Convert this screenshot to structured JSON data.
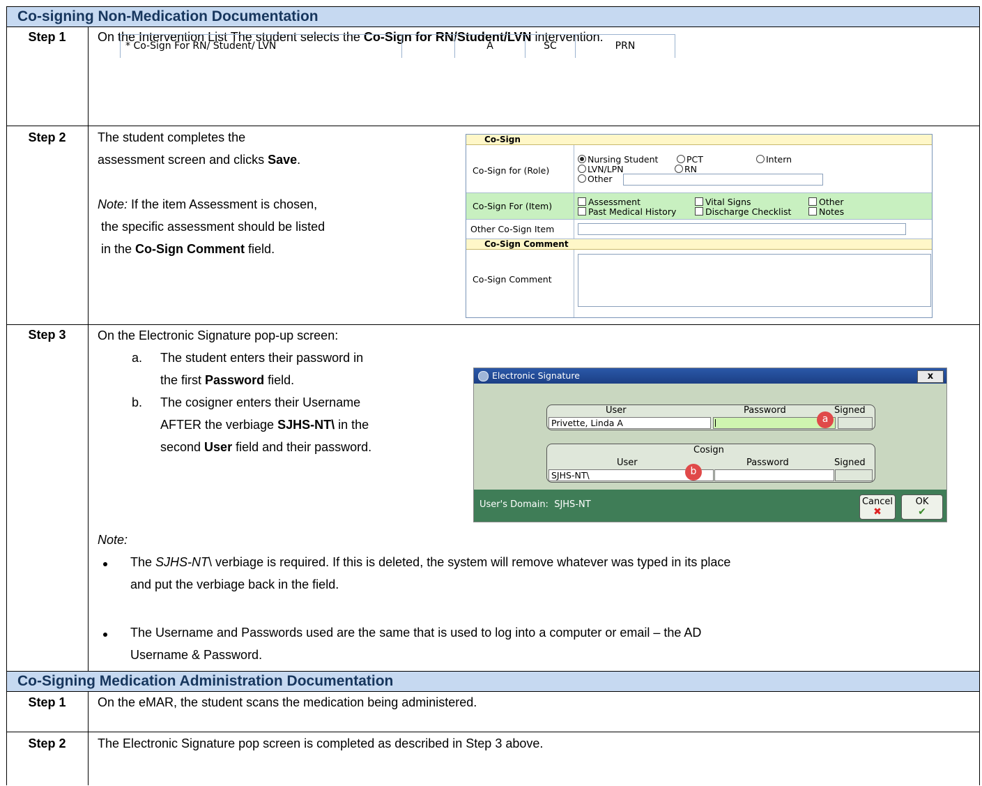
{
  "sections": [
    {
      "title": "Co-signing Non-Medication Documentation"
    },
    {
      "title": "Co-Signing Medication Administration Documentation"
    }
  ],
  "nonmed": {
    "step1": {
      "label": "Step 1",
      "pre": "On the Intervention List The student selects the ",
      "bold": "Co-Sign for RN/Student/LVN",
      "post": " intervention.",
      "intervention": {
        "name": "* Co-Sign For RN/ Student/ LVN",
        "col2": "",
        "col3": "A",
        "col4": "SC",
        "col5": "PRN"
      }
    },
    "step2": {
      "label": "Step 2",
      "line1": "The student completes the",
      "line2_pre": "assessment screen and clicks ",
      "line2_bold": "Save",
      "line2_post": ".",
      "note_label": "Note:",
      "note_line1": " If the item Assessment is chosen,",
      "note_line2": " the specific assessment should be listed",
      "note_line3_pre": " in the ",
      "note_line3_bold": "Co-Sign Comment",
      "note_line3_post": " field.",
      "form": {
        "hdr1": "Co-Sign",
        "role_label": "Co-Sign for (Role)",
        "roles": [
          "Nursing Student",
          "PCT",
          "Intern",
          "LVN/LPN",
          "RN",
          "Other"
        ],
        "role_selected": "Nursing Student",
        "item_label": "Co-Sign For (Item)",
        "items": [
          "Assessment",
          "Vital Signs",
          "Other",
          "Past Medical History",
          "Discharge Checklist",
          "Notes"
        ],
        "other_label": "Other Co-Sign Item",
        "hdr2": "Co-Sign Comment",
        "comment_label": "Co-Sign Comment"
      }
    },
    "step3": {
      "label": "Step 3",
      "intro": "On the Electronic Signature pop-up screen:",
      "a_marker": "a.",
      "a_line1": "The student enters their password in",
      "a_line2_pre": "the first ",
      "a_line2_bold": "Password",
      "a_line2_post": " field.",
      "b_marker": "b.",
      "b_line1": "The cosigner enters their Username",
      "b_line2_pre": "AFTER the verbiage ",
      "b_line2_bold": "SJHS-NT\\",
      "b_line2_post": " in the",
      "b_line3_pre": "second ",
      "b_line3_bold": "User",
      "b_line3_post": " field and their password.",
      "note_label": "Note:",
      "bullet1_pre": "The ",
      "bullet1_ital": "SJHS-NT",
      "bullet1_line1": "\\ verbiage is required. If this is deleted, the system will remove whatever was typed in its place",
      "bullet1_line2": "and put the verbiage back in the field.",
      "bullet2_line1": "The Username and Passwords used are the same that is used to log into a computer or email – the AD",
      "bullet2_line2": "Username & Password.",
      "dialog": {
        "title": "Electronic Signature",
        "close": "x",
        "user_hdr": "User",
        "password_hdr": "Password",
        "signed_hdr": "Signed",
        "user_value": "Privette, Linda A",
        "cosign_hdr": "Cosign",
        "cosign_user_value": "SJHS-NT\\",
        "badge_a": "a",
        "badge_b": "b",
        "domain": "User's Domain:  SJHS-NT",
        "cancel": "Cancel",
        "ok": "OK"
      }
    }
  },
  "med": {
    "step1": {
      "label": "Step 1",
      "text": "On the eMAR, the student scans the medication being administered."
    },
    "step2": {
      "label": "Step 2",
      "text": "The Electronic Signature pop screen is completed as described in Step 3 above."
    }
  }
}
